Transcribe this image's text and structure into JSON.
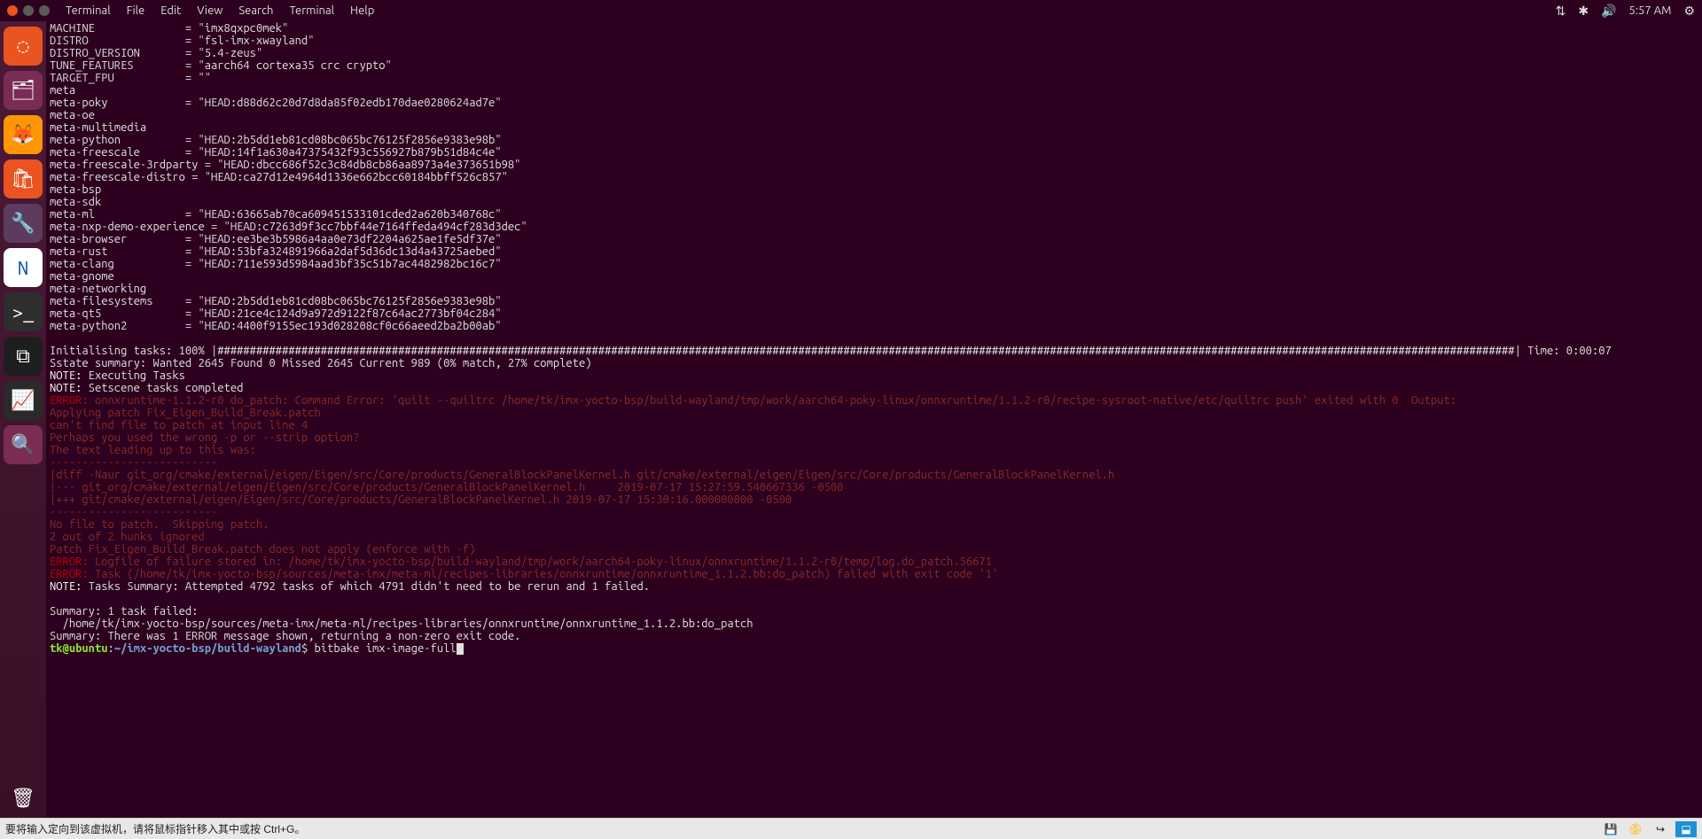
{
  "topbar": {
    "menu": [
      "Terminal",
      "File",
      "Edit",
      "View",
      "Search",
      "Terminal",
      "Help"
    ],
    "time": "5:57 AM",
    "status_icons": [
      "⇅",
      "✱",
      "🔊",
      "⚙"
    ]
  },
  "launcher": [
    {
      "name": "dash",
      "bg": "#e95420",
      "glyph": "◌"
    },
    {
      "name": "files",
      "bg": "#7a2c54",
      "glyph": "🗂"
    },
    {
      "name": "firefox",
      "bg": "#ff9500",
      "glyph": "🦊"
    },
    {
      "name": "software",
      "bg": "#e95420",
      "glyph": "🛍"
    },
    {
      "name": "settings",
      "bg": "#5c3b5d",
      "glyph": "🔧"
    },
    {
      "name": "nxp",
      "bg": "#ffffff",
      "glyph": "N"
    },
    {
      "name": "terminal",
      "bg": "#2e2e2e",
      "glyph": ">_"
    },
    {
      "name": "vscode",
      "bg": "#1e1e1e",
      "glyph": "⧉"
    },
    {
      "name": "monitor",
      "bg": "#2a2a2a",
      "glyph": "📈"
    },
    {
      "name": "viewer",
      "bg": "#7a2c54",
      "glyph": "🔍"
    }
  ],
  "launcher_bottom": {
    "name": "trash",
    "bg": "transparent",
    "glyph": "🗑"
  },
  "body_lines": [
    {
      "t": "MACHINE              = \"imx8qxpc0mek\"",
      "c": "white"
    },
    {
      "t": "DISTRO               = \"fsl-imx-xwayland\"",
      "c": "white"
    },
    {
      "t": "DISTRO_VERSION       = \"5.4-zeus\"",
      "c": "white"
    },
    {
      "t": "TUNE_FEATURES        = \"aarch64 cortexa35 crc crypto\"",
      "c": "white"
    },
    {
      "t": "TARGET_FPU           = \"\"",
      "c": "white"
    },
    {
      "t": "meta                 ",
      "c": "white"
    },
    {
      "t": "meta-poky            = \"HEAD:d88d62c20d7d8da85f02edb170dae0280624ad7e\"",
      "c": "white"
    },
    {
      "t": "meta-oe              ",
      "c": "white"
    },
    {
      "t": "meta-multimedia      ",
      "c": "white"
    },
    {
      "t": "meta-python          = \"HEAD:2b5dd1eb81cd08bc065bc76125f2856e9383e98b\"",
      "c": "white"
    },
    {
      "t": "meta-freescale       = \"HEAD:14f1a630a47375432f93c556927b879b51d84c4e\"",
      "c": "white"
    },
    {
      "t": "meta-freescale-3rdparty = \"HEAD:dbcc686f52c3c84db8cb86aa8973a4e373651b98\"",
      "c": "white"
    },
    {
      "t": "meta-freescale-distro = \"HEAD:ca27d12e4964d1336e662bcc60184bbff526c857\"",
      "c": "white"
    },
    {
      "t": "meta-bsp             ",
      "c": "white"
    },
    {
      "t": "meta-sdk             ",
      "c": "white"
    },
    {
      "t": "meta-ml              = \"HEAD:63665ab70ca609451533101cded2a620b340768c\"",
      "c": "white"
    },
    {
      "t": "meta-nxp-demo-experience = \"HEAD:c7263d9f3cc7bbf44e7164ffeda494cf283d3dec\"",
      "c": "white"
    },
    {
      "t": "meta-browser         = \"HEAD:ee3be3b5986a4aa0e73df2204a625ae1fe5df37e\"",
      "c": "white"
    },
    {
      "t": "meta-rust            = \"HEAD:53bfa324891966a2daf5d36dc13d4a43725aebed\"",
      "c": "white"
    },
    {
      "t": "meta-clang           = \"HEAD:711e593d5984aad3bf35c51b7ac4482982bc16c7\"",
      "c": "white"
    },
    {
      "t": "meta-gnome           ",
      "c": "white"
    },
    {
      "t": "meta-networking      ",
      "c": "white"
    },
    {
      "t": "meta-filesystems     = \"HEAD:2b5dd1eb81cd08bc065bc76125f2856e9383e98b\"",
      "c": "white"
    },
    {
      "t": "meta-qt5             = \"HEAD:21ce4c124d9a972d9122f87c64ac2773bf04c284\"",
      "c": "white"
    },
    {
      "t": "meta-python2         = \"HEAD:4400f9155ec193d028208cf0c66aeed2ba2b00ab\"",
      "c": "white"
    },
    {
      "t": "",
      "c": "white"
    },
    {
      "t": "Initialising tasks: 100% |#########################################################################################################################################################################################################| Time: 0:00:07",
      "c": "white"
    },
    {
      "t": "Sstate summary: Wanted 2645 Found 0 Missed 2645 Current 989 (0% match, 27% complete)",
      "c": "white"
    },
    {
      "label": "NOTE:",
      "t": " Executing Tasks",
      "c": "white"
    },
    {
      "label": "NOTE:",
      "t": " Setscene tasks completed",
      "c": "white"
    },
    {
      "label": "ERROR:",
      "t": " onnxruntime-1.1.2-r0 do_patch: Command Error: 'quilt --quiltrc /home/tk/imx-yocto-bsp/build-wayland/tmp/work/aarch64-poky-linux/onnxruntime/1.1.2-r0/recipe-sysroot-native/etc/quiltrc push' exited with 0  Output:",
      "c": "err"
    },
    {
      "t": "Applying patch Fix_Eigen_Build_Break.patch",
      "c": "err"
    },
    {
      "t": "can't find file to patch at input line 4",
      "c": "err"
    },
    {
      "t": "Perhaps you used the wrong -p or --strip option?",
      "c": "err"
    },
    {
      "t": "The text leading up to this was:",
      "c": "err"
    },
    {
      "t": "--------------------------",
      "c": "err"
    },
    {
      "t": "|diff -Naur git_org/cmake/external/eigen/Eigen/src/Core/products/GeneralBlockPanelKernel.h git/cmake/external/eigen/Eigen/src/Core/products/GeneralBlockPanelKernel.h",
      "c": "err"
    },
    {
      "t": "|--- git_org/cmake/external/eigen/Eigen/src/Core/products/GeneralBlockPanelKernel.h     2019-07-17 15:27:59.540667336 -0500",
      "c": "err"
    },
    {
      "t": "|+++ git/cmake/external/eigen/Eigen/src/Core/products/GeneralBlockPanelKernel.h 2019-07-17 15:30:16.000000000 -0500",
      "c": "err"
    },
    {
      "t": "--------------------------",
      "c": "err"
    },
    {
      "t": "No file to patch.  Skipping patch.",
      "c": "err"
    },
    {
      "t": "2 out of 2 hunks ignored",
      "c": "err"
    },
    {
      "t": "Patch Fix_Eigen_Build_Break.patch does not apply (enforce with -f)",
      "c": "err"
    },
    {
      "label": "ERROR:",
      "t": " Logfile of failure stored in: /home/tk/imx-yocto-bsp/build-wayland/tmp/work/aarch64-poky-linux/onnxruntime/1.1.2-r0/temp/log.do_patch.56671",
      "c": "err"
    },
    {
      "label": "ERROR:",
      "t": " Task (/home/tk/imx-yocto-bsp/sources/meta-imx/meta-ml/recipes-libraries/onnxruntime/onnxruntime_1.1.2.bb:do_patch) failed with exit code '1'",
      "c": "err"
    },
    {
      "label": "NOTE:",
      "t": " Tasks Summary: Attempted 4792 tasks of which 4791 didn't need to be rerun and 1 failed.",
      "c": "white"
    },
    {
      "t": "",
      "c": "white"
    },
    {
      "t": "Summary: 1 task failed:",
      "c": "white"
    },
    {
      "t": "  /home/tk/imx-yocto-bsp/sources/meta-imx/meta-ml/recipes-libraries/onnxruntime/onnxruntime_1.1.2.bb:do_patch",
      "c": "white"
    },
    {
      "t": "Summary: There was 1 ERROR message shown, returning a non-zero exit code.",
      "c": "white"
    }
  ],
  "prompt": {
    "user_host": "tk@ubuntu",
    "colon": ":",
    "path": "~/imx-yocto-bsp/build-wayland",
    "symbol": "$ ",
    "command": "bitbake imx-image-full"
  },
  "bottombar": {
    "hint": "要将输入定向到该虚拟机，请将鼠标指针移入其中或按 Ctrl+G。",
    "icons": [
      "💾",
      "📀",
      "↪",
      "⬓"
    ]
  }
}
